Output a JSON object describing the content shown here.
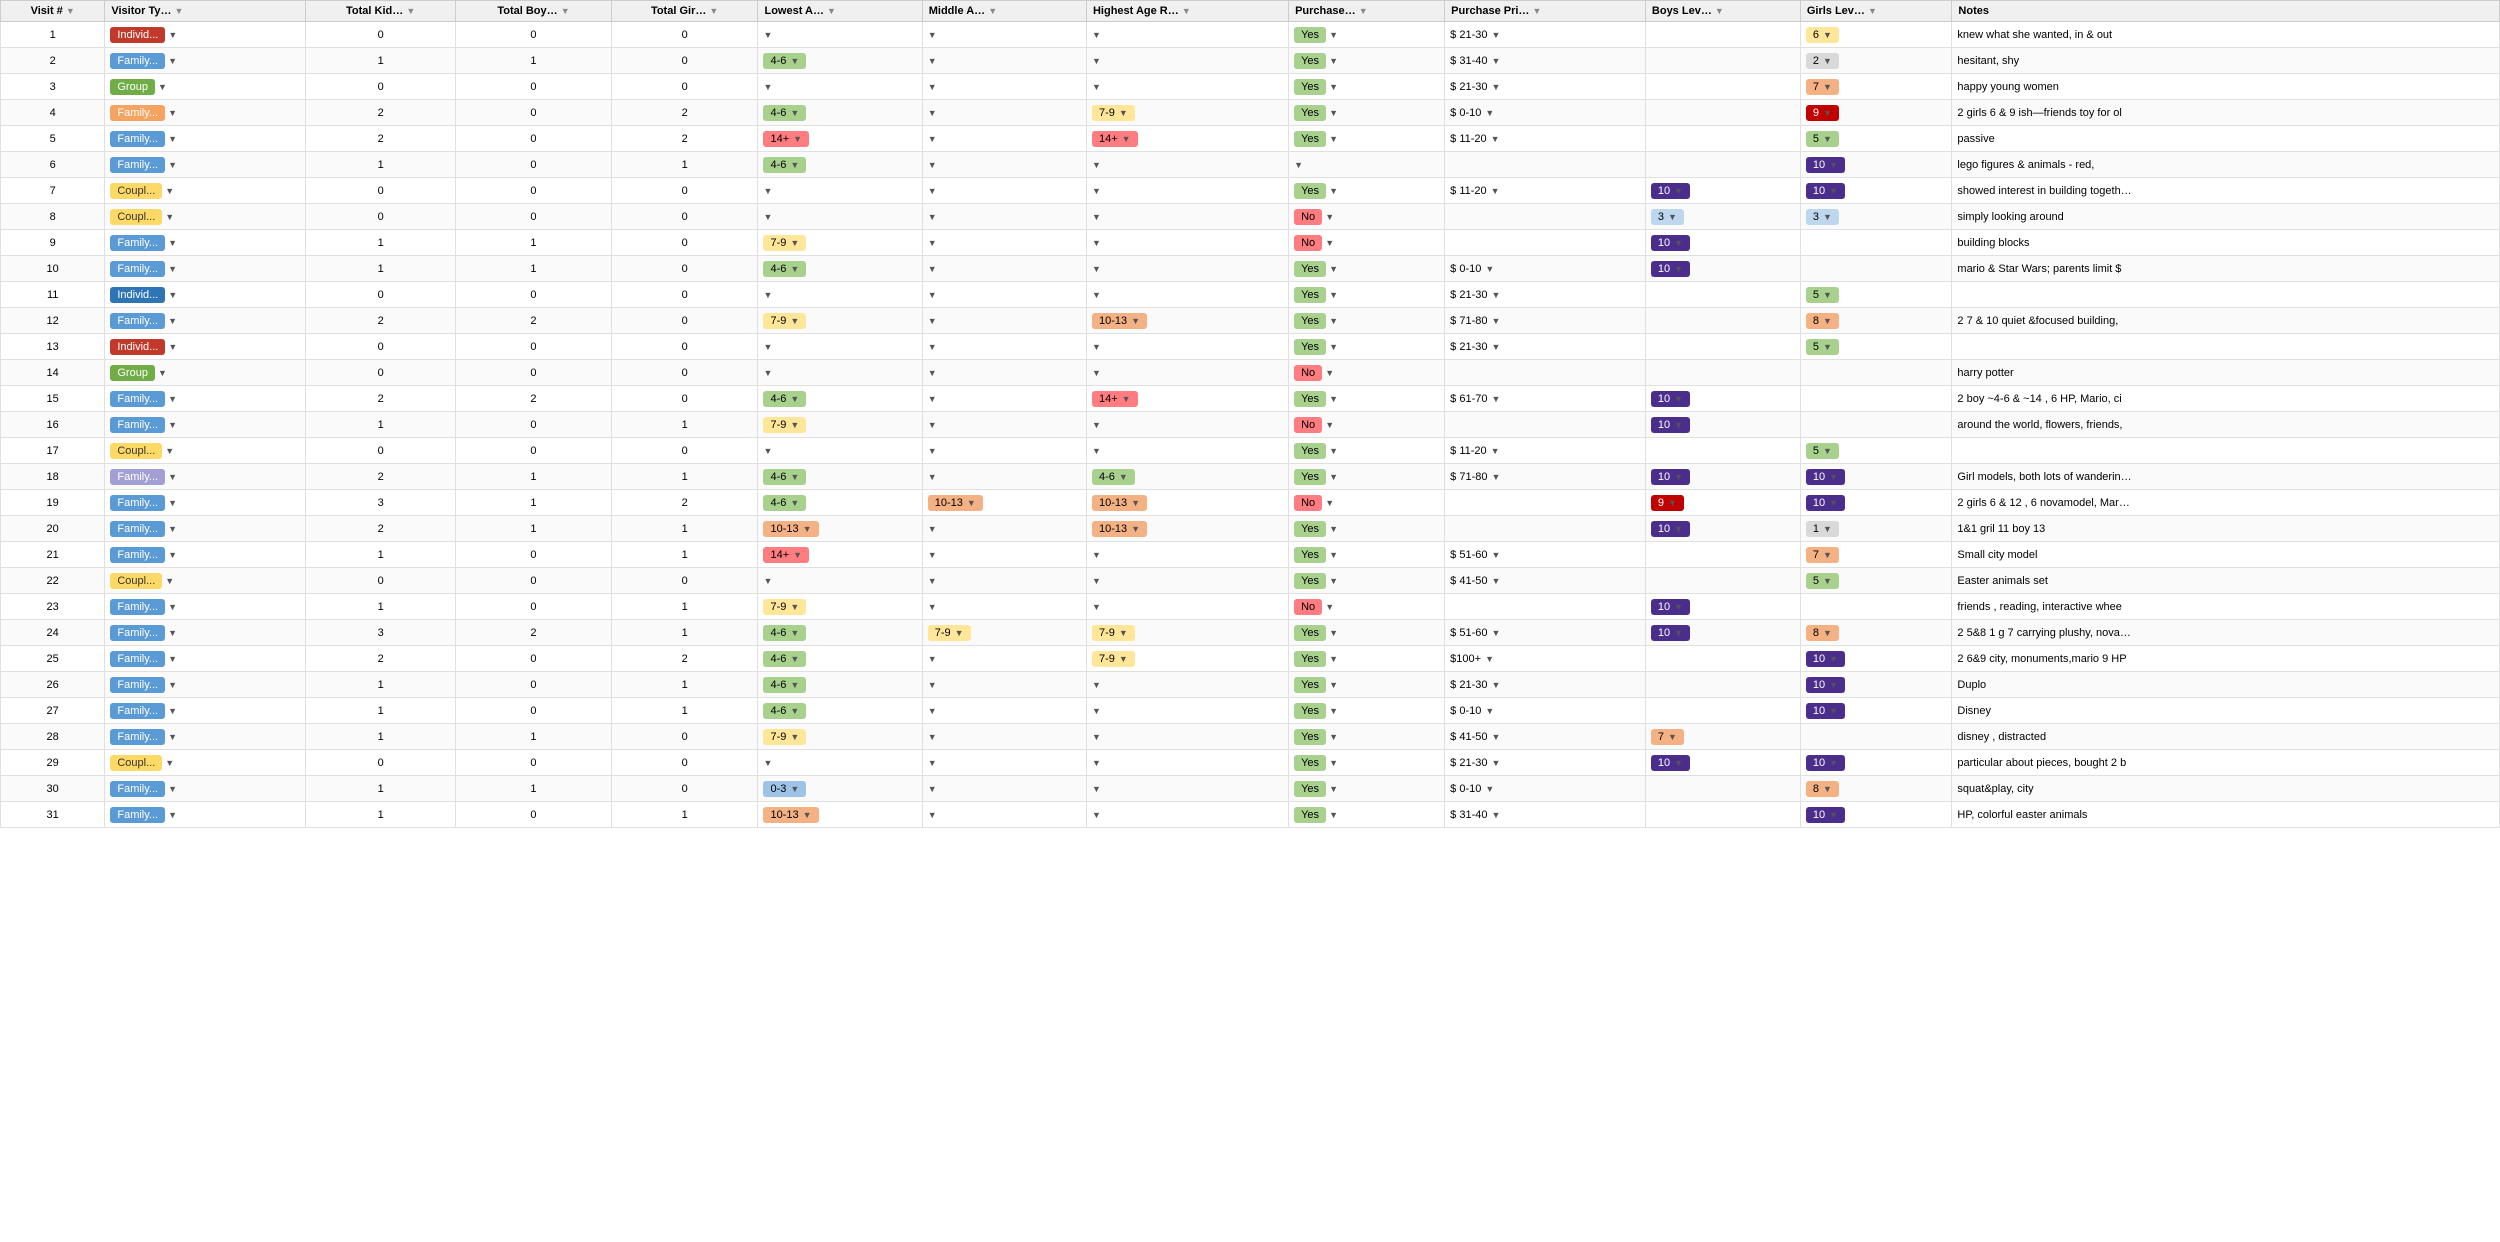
{
  "columns": [
    {
      "id": "visit",
      "label": "Visit #"
    },
    {
      "id": "type",
      "label": "Visitor Ty…"
    },
    {
      "id": "total_kids",
      "label": "Total Kid…"
    },
    {
      "id": "total_boys",
      "label": "Total Boy…"
    },
    {
      "id": "total_girls",
      "label": "Total Gir…"
    },
    {
      "id": "lowest_age",
      "label": "Lowest A…"
    },
    {
      "id": "middle_age",
      "label": "Middle A…"
    },
    {
      "id": "highest_age",
      "label": "Highest Age R…"
    },
    {
      "id": "purchased",
      "label": "Purchase…"
    },
    {
      "id": "purchase_price",
      "label": "Purchase Pri…"
    },
    {
      "id": "boys_level",
      "label": "Boys Lev…"
    },
    {
      "id": "girls_level",
      "label": "Girls Lev…"
    },
    {
      "id": "notes",
      "label": "Notes"
    }
  ],
  "rows": [
    {
      "visit": 1,
      "type": "Individ...",
      "type_class": "badge-individual",
      "total_kids": 0,
      "total_boys": 0,
      "total_girls": 0,
      "lowest_age": "",
      "middle_age": "",
      "highest_age": "",
      "purchased": "Yes",
      "purchased_class": "purchase-yes",
      "purchase_price": "$ 21-30",
      "boys_level": "",
      "boys_class": "",
      "girls_level": "6",
      "girls_class": "level-6",
      "notes": "knew what she wanted, in & out"
    },
    {
      "visit": 2,
      "type": "Family...",
      "type_class": "badge-family-blue",
      "total_kids": 1,
      "total_boys": 1,
      "total_girls": 0,
      "lowest_age": "4-6",
      "lowest_class": "age-4-6",
      "middle_age": "",
      "highest_age": "",
      "purchased": "Yes",
      "purchased_class": "purchase-yes",
      "purchase_price": "$ 31-40",
      "boys_level": "",
      "boys_class": "",
      "girls_level": "2",
      "girls_class": "level-2",
      "notes": "hesitant, shy"
    },
    {
      "visit": 3,
      "type": "Group",
      "type_class": "badge-group",
      "total_kids": 0,
      "total_boys": 0,
      "total_girls": 0,
      "lowest_age": "",
      "middle_age": "",
      "highest_age": "",
      "purchased": "Yes",
      "purchased_class": "purchase-yes",
      "purchase_price": "$ 21-30",
      "boys_level": "",
      "boys_class": "",
      "girls_level": "7",
      "girls_class": "level-7",
      "notes": "happy young women"
    },
    {
      "visit": 4,
      "type": "Family...",
      "type_class": "badge-family-orange",
      "total_kids": 2,
      "total_boys": 0,
      "total_girls": 2,
      "lowest_age": "4-6",
      "lowest_class": "age-4-6",
      "middle_age": "",
      "highest_age": "7-9",
      "highest_class": "age-7-9",
      "purchased": "Yes",
      "purchased_class": "purchase-yes",
      "purchase_price": "$ 0-10",
      "boys_level": "",
      "boys_class": "",
      "girls_level": "9",
      "girls_class": "level-9",
      "notes": "2 girls 6 & 9 ish—friends toy for ol"
    },
    {
      "visit": 5,
      "type": "Family...",
      "type_class": "badge-family-blue",
      "total_kids": 2,
      "total_boys": 0,
      "total_girls": 2,
      "lowest_age": "14+",
      "lowest_class": "age-14plus",
      "middle_age": "",
      "highest_age": "14+",
      "highest_class": "age-14plus",
      "purchased": "Yes",
      "purchased_class": "purchase-yes",
      "purchase_price": "$ 11-20",
      "boys_level": "",
      "boys_class": "",
      "girls_level": "5",
      "girls_class": "level-5",
      "notes": "passive"
    },
    {
      "visit": 6,
      "type": "Family...",
      "type_class": "badge-family-blue",
      "total_kids": 1,
      "total_boys": 0,
      "total_girls": 1,
      "lowest_age": "4-6",
      "lowest_class": "age-4-6",
      "middle_age": "",
      "highest_age": "",
      "purchased": "",
      "purchased_class": "",
      "purchase_price": "",
      "boys_level": "",
      "boys_class": "",
      "girls_level": "10",
      "girls_class": "level-10",
      "notes": "lego figures & animals - red,"
    },
    {
      "visit": 7,
      "type": "Coupl...",
      "type_class": "badge-couple",
      "total_kids": 0,
      "total_boys": 0,
      "total_girls": 0,
      "lowest_age": "",
      "middle_age": "",
      "highest_age": "",
      "purchased": "Yes",
      "purchased_class": "purchase-yes",
      "purchase_price": "$ 11-20",
      "boys_level": "10",
      "boys_class": "level-10",
      "girls_level": "10",
      "girls_class": "level-10",
      "notes": "showed interest in building togeth…"
    },
    {
      "visit": 8,
      "type": "Coupl...",
      "type_class": "badge-couple",
      "total_kids": 0,
      "total_boys": 0,
      "total_girls": 0,
      "lowest_age": "",
      "middle_age": "",
      "highest_age": "",
      "purchased": "No",
      "purchased_class": "purchase-no",
      "purchase_price": "",
      "boys_level": "3",
      "boys_class": "level-3",
      "girls_level": "3",
      "girls_class": "level-3",
      "notes": "simply looking around"
    },
    {
      "visit": 9,
      "type": "Family...",
      "type_class": "badge-family-blue",
      "total_kids": 1,
      "total_boys": 1,
      "total_girls": 0,
      "lowest_age": "7-9",
      "lowest_class": "age-7-9",
      "middle_age": "",
      "highest_age": "",
      "purchased": "No",
      "purchased_class": "purchase-no",
      "purchase_price": "",
      "boys_level": "10",
      "boys_class": "level-10",
      "girls_level": "",
      "girls_class": "",
      "notes": "building blocks"
    },
    {
      "visit": 10,
      "type": "Family...",
      "type_class": "badge-family-blue",
      "total_kids": 1,
      "total_boys": 1,
      "total_girls": 0,
      "lowest_age": "4-6",
      "lowest_class": "age-4-6",
      "middle_age": "",
      "highest_age": "",
      "purchased": "Yes",
      "purchased_class": "purchase-yes",
      "purchase_price": "$ 0-10",
      "boys_level": "10",
      "boys_class": "level-10",
      "girls_level": "",
      "girls_class": "",
      "notes": "mario & Star Wars; parents limit $"
    },
    {
      "visit": 11,
      "type": "Individ...",
      "type_class": "badge-individual-blue",
      "total_kids": 0,
      "total_boys": 0,
      "total_girls": 0,
      "lowest_age": "",
      "middle_age": "",
      "highest_age": "",
      "purchased": "Yes",
      "purchased_class": "purchase-yes",
      "purchase_price": "$ 21-30",
      "boys_level": "",
      "boys_class": "",
      "girls_level": "5",
      "girls_class": "level-5",
      "notes": ""
    },
    {
      "visit": 12,
      "type": "Family...",
      "type_class": "badge-family-blue",
      "total_kids": 2,
      "total_boys": 2,
      "total_girls": 0,
      "lowest_age": "7-9",
      "lowest_class": "age-7-9",
      "middle_age": "",
      "highest_age": "10-13",
      "highest_class": "age-10-13",
      "purchased": "Yes",
      "purchased_class": "purchase-yes",
      "purchase_price": "$ 71-80",
      "boys_level": "",
      "boys_class": "",
      "girls_level": "8",
      "girls_class": "level-8",
      "notes": "2 7 & 10 quiet &focused building,"
    },
    {
      "visit": 13,
      "type": "Individ...",
      "type_class": "badge-individual",
      "total_kids": 0,
      "total_boys": 0,
      "total_girls": 0,
      "lowest_age": "",
      "middle_age": "",
      "highest_age": "",
      "purchased": "Yes",
      "purchased_class": "purchase-yes",
      "purchase_price": "$ 21-30",
      "boys_level": "",
      "boys_class": "",
      "girls_level": "5",
      "girls_class": "level-5",
      "notes": ""
    },
    {
      "visit": 14,
      "type": "Group",
      "type_class": "badge-group",
      "total_kids": 0,
      "total_boys": 0,
      "total_girls": 0,
      "lowest_age": "",
      "middle_age": "",
      "highest_age": "",
      "purchased": "No",
      "purchased_class": "purchase-no",
      "purchase_price": "",
      "boys_level": "",
      "boys_class": "",
      "girls_level": "",
      "girls_class": "",
      "notes": "harry potter"
    },
    {
      "visit": 15,
      "type": "Family...",
      "type_class": "badge-family-blue",
      "total_kids": 2,
      "total_boys": 2,
      "total_girls": 0,
      "lowest_age": "4-6",
      "lowest_class": "age-4-6",
      "middle_age": "",
      "highest_age": "14+",
      "highest_class": "age-14plus",
      "purchased": "Yes",
      "purchased_class": "purchase-yes",
      "purchase_price": "$ 61-70",
      "boys_level": "10",
      "boys_class": "level-10",
      "girls_level": "",
      "girls_class": "",
      "notes": "2 boy ~4-6 & ~14 , 6 HP, Mario, ci"
    },
    {
      "visit": 16,
      "type": "Family...",
      "type_class": "badge-family-blue",
      "total_kids": 1,
      "total_boys": 0,
      "total_girls": 1,
      "lowest_age": "7-9",
      "lowest_class": "age-7-9",
      "middle_age": "",
      "highest_age": "",
      "purchased": "No",
      "purchased_class": "purchase-no",
      "purchase_price": "",
      "boys_level": "10",
      "boys_class": "level-10",
      "girls_level": "",
      "girls_class": "",
      "notes": "around the world, flowers, friends,"
    },
    {
      "visit": 17,
      "type": "Coupl...",
      "type_class": "badge-couple",
      "total_kids": 0,
      "total_boys": 0,
      "total_girls": 0,
      "lowest_age": "",
      "middle_age": "",
      "highest_age": "",
      "purchased": "Yes",
      "purchased_class": "purchase-yes",
      "purchase_price": "$ 11-20",
      "boys_level": "",
      "boys_class": "",
      "girls_level": "5",
      "girls_class": "level-5",
      "notes": ""
    },
    {
      "visit": 18,
      "type": "Family...",
      "type_class": "badge-family-purple",
      "total_kids": 2,
      "total_boys": 1,
      "total_girls": 1,
      "lowest_age": "4-6",
      "lowest_class": "age-4-6",
      "middle_age": "",
      "highest_age": "4-6",
      "highest_class": "age-4-6",
      "purchased": "Yes",
      "purchased_class": "purchase-yes",
      "purchase_price": "$ 71-80",
      "boys_level": "10",
      "boys_class": "level-10",
      "girls_level": "10",
      "girls_class": "level-10",
      "notes": "Girl models, both lots of wanderin…"
    },
    {
      "visit": 19,
      "type": "Family...",
      "type_class": "badge-family-blue",
      "total_kids": 3,
      "total_boys": 1,
      "total_girls": 2,
      "lowest_age": "4-6",
      "lowest_class": "age-4-6",
      "middle_age": "10-13",
      "middle_class": "age-10-13",
      "highest_age": "10-13",
      "highest_class": "age-10-13",
      "purchased": "No",
      "purchased_class": "purchase-no",
      "purchase_price": "",
      "boys_level": "9",
      "boys_class": "level-9",
      "girls_level": "10",
      "girls_class": "level-10",
      "notes": "2 girls 6 & 12 , 6 novamodel, Mar…"
    },
    {
      "visit": 20,
      "type": "Family...",
      "type_class": "badge-family-blue",
      "total_kids": 2,
      "total_boys": 1,
      "total_girls": 1,
      "lowest_age": "10-13",
      "lowest_class": "age-10-13",
      "middle_age": "",
      "highest_age": "10-13",
      "highest_class": "age-10-13",
      "purchased": "Yes",
      "purchased_class": "purchase-yes",
      "purchase_price": "",
      "boys_level": "10",
      "boys_class": "level-10",
      "girls_level": "1",
      "girls_class": "level-1",
      "notes": "1&1 gril 11 boy 13"
    },
    {
      "visit": 21,
      "type": "Family...",
      "type_class": "badge-family-blue",
      "total_kids": 1,
      "total_boys": 0,
      "total_girls": 1,
      "lowest_age": "14+",
      "lowest_class": "age-14plus",
      "middle_age": "",
      "highest_age": "",
      "purchased": "Yes",
      "purchased_class": "purchase-yes",
      "purchase_price": "$ 51-60",
      "boys_level": "",
      "boys_class": "",
      "girls_level": "7",
      "girls_class": "level-7",
      "notes": "Small city model"
    },
    {
      "visit": 22,
      "type": "Coupl...",
      "type_class": "badge-couple",
      "total_kids": 0,
      "total_boys": 0,
      "total_girls": 0,
      "lowest_age": "",
      "middle_age": "",
      "highest_age": "",
      "purchased": "Yes",
      "purchased_class": "purchase-yes",
      "purchase_price": "$ 41-50",
      "boys_level": "",
      "boys_class": "",
      "girls_level": "5",
      "girls_class": "level-5",
      "notes": "Easter animals set"
    },
    {
      "visit": 23,
      "type": "Family...",
      "type_class": "badge-family-blue",
      "total_kids": 1,
      "total_boys": 0,
      "total_girls": 1,
      "lowest_age": "7-9",
      "lowest_class": "age-7-9",
      "middle_age": "",
      "highest_age": "",
      "purchased": "No",
      "purchased_class": "purchase-no",
      "purchase_price": "",
      "boys_level": "10",
      "boys_class": "level-10",
      "girls_level": "",
      "girls_class": "",
      "notes": "friends , reading, interactive whee"
    },
    {
      "visit": 24,
      "type": "Family...",
      "type_class": "badge-family-blue",
      "total_kids": 3,
      "total_boys": 2,
      "total_girls": 1,
      "lowest_age": "4-6",
      "lowest_class": "age-4-6",
      "middle_age": "7-9",
      "middle_class": "age-7-9",
      "highest_age": "7-9",
      "highest_class": "age-7-9",
      "purchased": "Yes",
      "purchased_class": "purchase-yes",
      "purchase_price": "$ 51-60",
      "boys_level": "10",
      "boys_class": "level-10",
      "girls_level": "8",
      "girls_class": "level-8",
      "notes": "2 5&8 1 g 7 carrying plushy, nova…"
    },
    {
      "visit": 25,
      "type": "Family...",
      "type_class": "badge-family-blue",
      "total_kids": 2,
      "total_boys": 0,
      "total_girls": 2,
      "lowest_age": "4-6",
      "lowest_class": "age-4-6",
      "middle_age": "",
      "highest_age": "7-9",
      "highest_class": "age-7-9",
      "purchased": "Yes",
      "purchased_class": "purchase-yes",
      "purchase_price": "$100+",
      "boys_level": "",
      "boys_class": "",
      "girls_level": "10",
      "girls_class": "level-10",
      "notes": "2 6&9 city, monuments,mario 9 HP"
    },
    {
      "visit": 26,
      "type": "Family...",
      "type_class": "badge-family-blue",
      "total_kids": 1,
      "total_boys": 0,
      "total_girls": 1,
      "lowest_age": "4-6",
      "lowest_class": "age-4-6",
      "middle_age": "",
      "highest_age": "",
      "purchased": "Yes",
      "purchased_class": "purchase-yes",
      "purchase_price": "$ 21-30",
      "boys_level": "",
      "boys_class": "",
      "girls_level": "10",
      "girls_class": "level-10",
      "notes": "Duplo"
    },
    {
      "visit": 27,
      "type": "Family...",
      "type_class": "badge-family-blue",
      "total_kids": 1,
      "total_boys": 0,
      "total_girls": 1,
      "lowest_age": "4-6",
      "lowest_class": "age-4-6",
      "middle_age": "",
      "highest_age": "",
      "purchased": "Yes",
      "purchased_class": "purchase-yes",
      "purchase_price": "$ 0-10",
      "boys_level": "",
      "boys_class": "",
      "girls_level": "10",
      "girls_class": "level-10",
      "notes": "Disney"
    },
    {
      "visit": 28,
      "type": "Family...",
      "type_class": "badge-family-blue",
      "total_kids": 1,
      "total_boys": 1,
      "total_girls": 0,
      "lowest_age": "7-9",
      "lowest_class": "age-7-9",
      "middle_age": "",
      "highest_age": "",
      "purchased": "Yes",
      "purchased_class": "purchase-yes",
      "purchase_price": "$ 41-50",
      "boys_level": "7",
      "boys_class": "level-7",
      "girls_level": "",
      "girls_class": "",
      "notes": "disney , distracted"
    },
    {
      "visit": 29,
      "type": "Coupl...",
      "type_class": "badge-couple",
      "total_kids": 0,
      "total_boys": 0,
      "total_girls": 0,
      "lowest_age": "",
      "middle_age": "",
      "highest_age": "",
      "purchased": "Yes",
      "purchased_class": "purchase-yes",
      "purchase_price": "$ 21-30",
      "boys_level": "10",
      "boys_class": "level-10",
      "girls_level": "10",
      "girls_class": "level-10",
      "notes": "particular about pieces, bought 2 b"
    },
    {
      "visit": 30,
      "type": "Family...",
      "type_class": "badge-family-blue",
      "total_kids": 1,
      "total_boys": 1,
      "total_girls": 0,
      "lowest_age": "0-3",
      "lowest_class": "age-0-3",
      "middle_age": "",
      "highest_age": "",
      "purchased": "Yes",
      "purchased_class": "purchase-yes",
      "purchase_price": "$ 0-10",
      "boys_level": "",
      "boys_class": "",
      "girls_level": "8",
      "girls_class": "level-8",
      "notes": "squat&play, city"
    },
    {
      "visit": 31,
      "type": "Family...",
      "type_class": "badge-family-blue",
      "total_kids": 1,
      "total_boys": 0,
      "total_girls": 1,
      "lowest_age": "10-13",
      "lowest_class": "age-10-13",
      "middle_age": "",
      "highest_age": "",
      "purchased": "Yes",
      "purchased_class": "purchase-yes",
      "purchase_price": "$ 31-40",
      "boys_level": "",
      "boys_class": "",
      "girls_level": "10",
      "girls_class": "level-10",
      "notes": "HP, colorful easter animals"
    }
  ]
}
